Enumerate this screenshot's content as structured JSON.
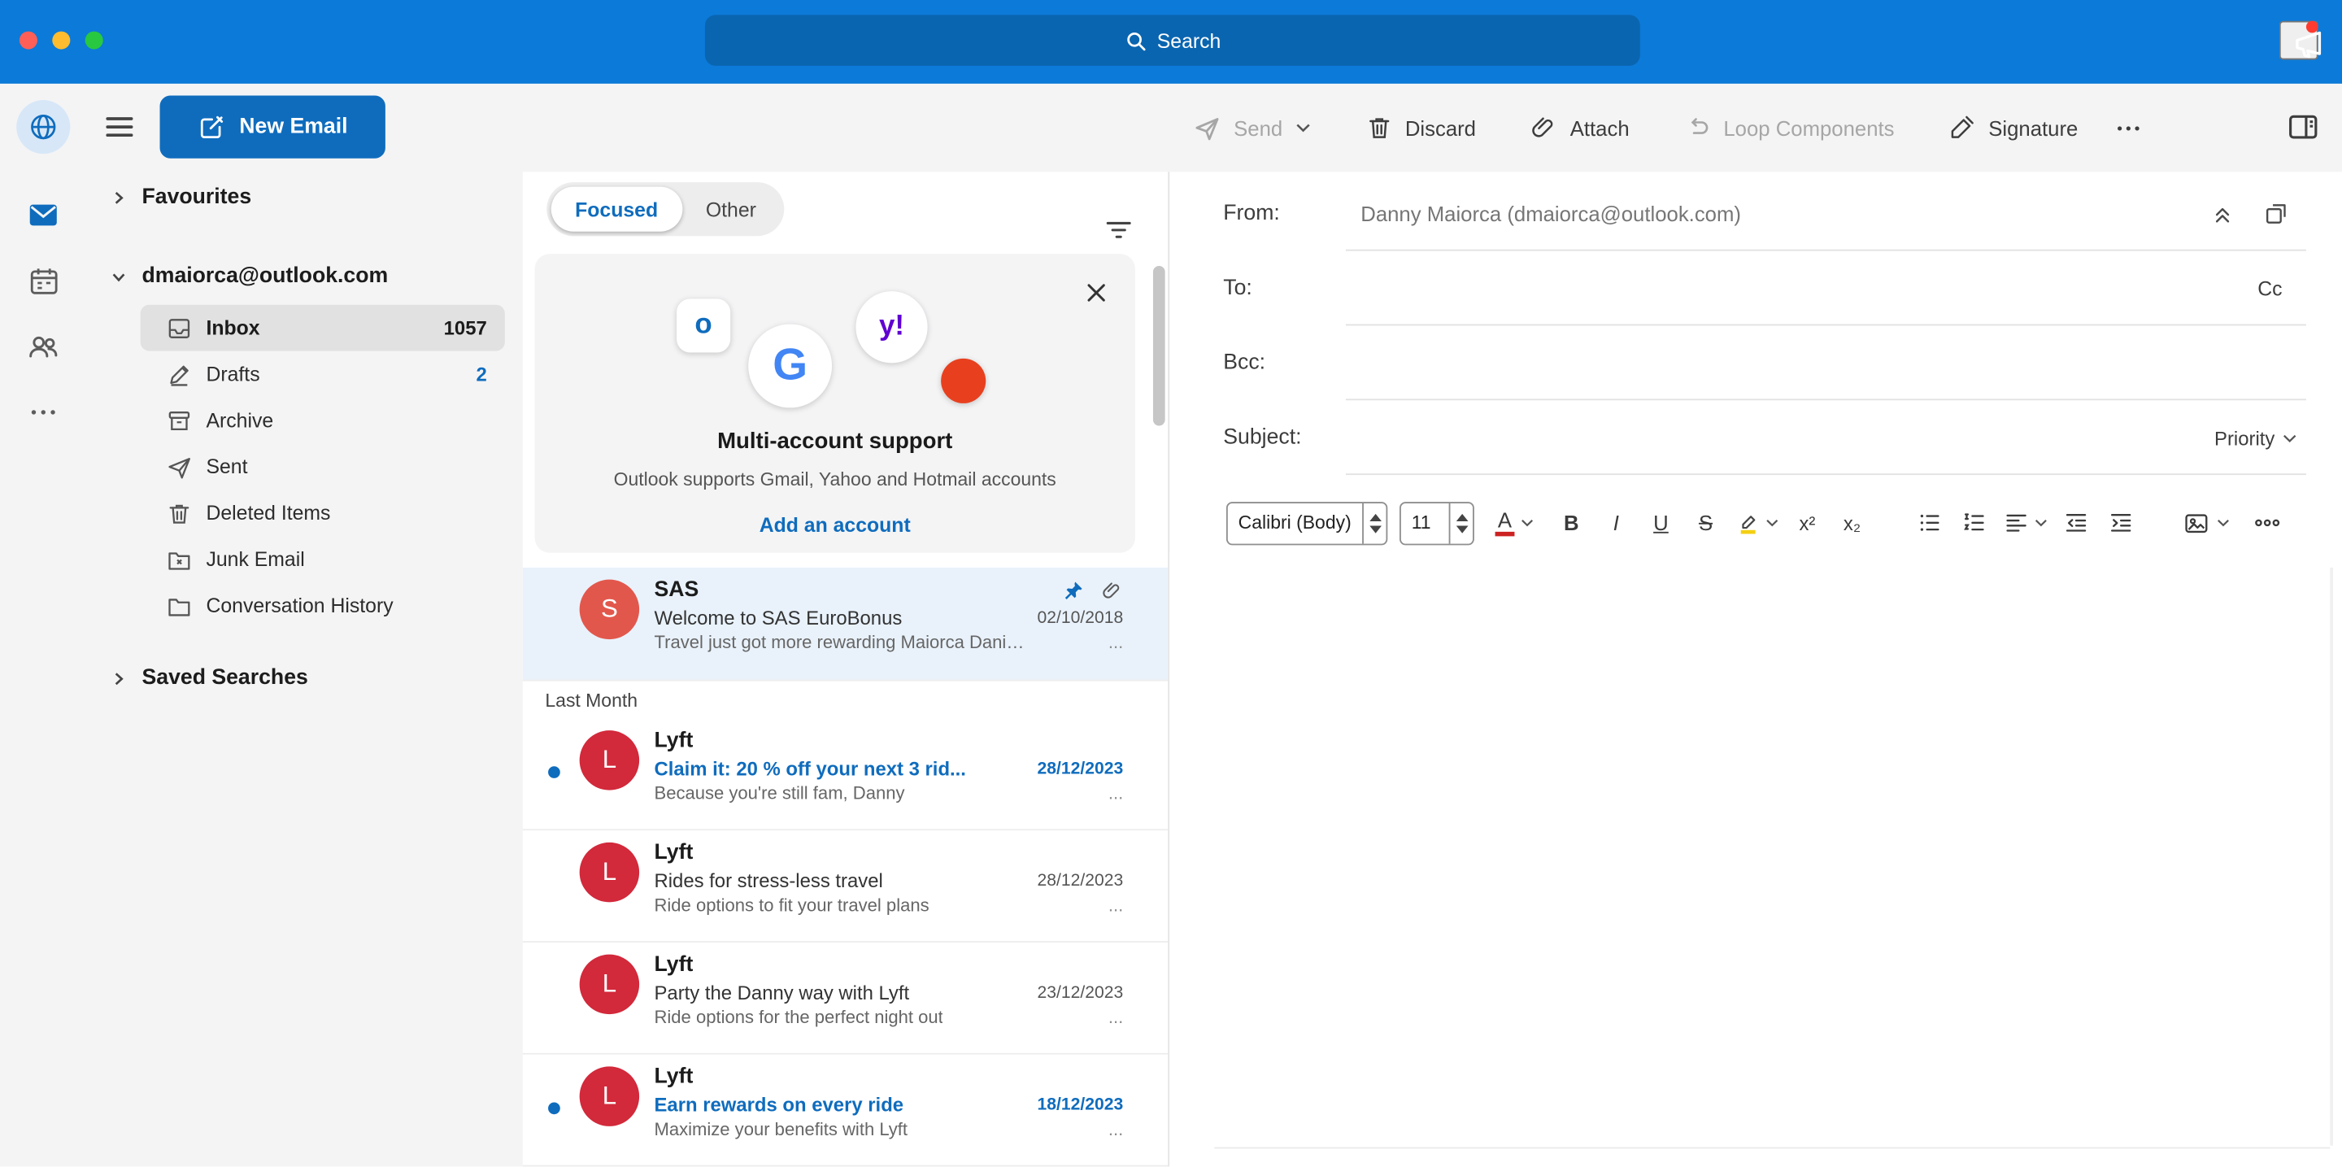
{
  "titlebar": {
    "search_placeholder": "Search"
  },
  "toolbar": {
    "new_email": "New Email",
    "send": "Send",
    "discard": "Discard",
    "attach": "Attach",
    "loop_components": "Loop Components",
    "signature": "Signature"
  },
  "sidebar": {
    "favourites": "Favourites",
    "account": "dmaiorca@outlook.com",
    "folders": [
      {
        "label": "Inbox",
        "count": "1057"
      },
      {
        "label": "Drafts",
        "count": "2"
      },
      {
        "label": "Archive",
        "count": ""
      },
      {
        "label": "Sent",
        "count": ""
      },
      {
        "label": "Deleted Items",
        "count": ""
      },
      {
        "label": "Junk Email",
        "count": ""
      },
      {
        "label": "Conversation History",
        "count": ""
      }
    ],
    "saved_searches": "Saved Searches"
  },
  "list": {
    "tabs": {
      "focused": "Focused",
      "other": "Other"
    },
    "promo": {
      "title": "Multi-account support",
      "subtitle": "Outlook supports Gmail, Yahoo and Hotmail accounts",
      "cta": "Add an account",
      "logos": {
        "outlook": "o",
        "google": "G",
        "yahoo": "y!"
      }
    },
    "group_label": "Last Month",
    "more": "...",
    "emails": [
      {
        "sender": "SAS",
        "initial": "S",
        "subject": "Welcome to SAS EuroBonus",
        "date": "02/10/2018",
        "preview": "Travel just got more rewarding Maiorca Daniele L..."
      },
      {
        "sender": "Lyft",
        "initial": "L",
        "subject": "Claim it: 20 % off your next 3 rid...",
        "date": "28/12/2023",
        "preview": "Because you're still fam, Danny"
      },
      {
        "sender": "Lyft",
        "initial": "L",
        "subject": "Rides for stress-less travel",
        "date": "28/12/2023",
        "preview": "Ride options to fit your travel plans"
      },
      {
        "sender": "Lyft",
        "initial": "L",
        "subject": "Party the Danny way with Lyft",
        "date": "23/12/2023",
        "preview": "Ride options for the perfect night out"
      },
      {
        "sender": "Lyft",
        "initial": "L",
        "subject": "Earn rewards on every ride",
        "date": "18/12/2023",
        "preview": "Maximize your benefits with Lyft"
      }
    ]
  },
  "compose": {
    "from_label": "From:",
    "from_value": "Danny Maiorca (dmaiorca@outlook.com)",
    "to_label": "To:",
    "cc_label": "Cc",
    "bcc_label": "Bcc:",
    "subject_label": "Subject:",
    "priority_label": "Priority",
    "format": {
      "font_name": "Calibri (Body)",
      "font_size": "11",
      "bold": "B",
      "italic": "I",
      "underline": "U",
      "strikethrough": "S",
      "font_color": "A",
      "superscript": "x²",
      "subscript": "x₂"
    }
  },
  "colors": {
    "accent_blue": "#0f6cbd",
    "titlebar_blue": "#0c7ad8",
    "unread_blue": "#0f6cbd",
    "avatar_sas": "#e2574c",
    "avatar_lyft": "#d2293b",
    "office_red": "#e8401f",
    "yahoo_purple": "#6001d2",
    "google_blue": "#4285f4"
  },
  "icons": {
    "search": "magnifier",
    "menu": "hamburger",
    "new_email": "pencil-square",
    "send": "paper-plane",
    "discard": "trash",
    "attach": "paperclip",
    "loop_components": "loop",
    "signature": "pen",
    "more": "ellipsis",
    "panel_toggle": "layout-right-panel",
    "filter": "filter-lines",
    "close": "x",
    "pin": "pushpin",
    "attachment": "paperclip",
    "collapse_fields": "double-chevron-up",
    "popout": "open-in-new-window",
    "globe": "globe",
    "mail": "envelope",
    "calendar": "calendar",
    "people": "people"
  }
}
